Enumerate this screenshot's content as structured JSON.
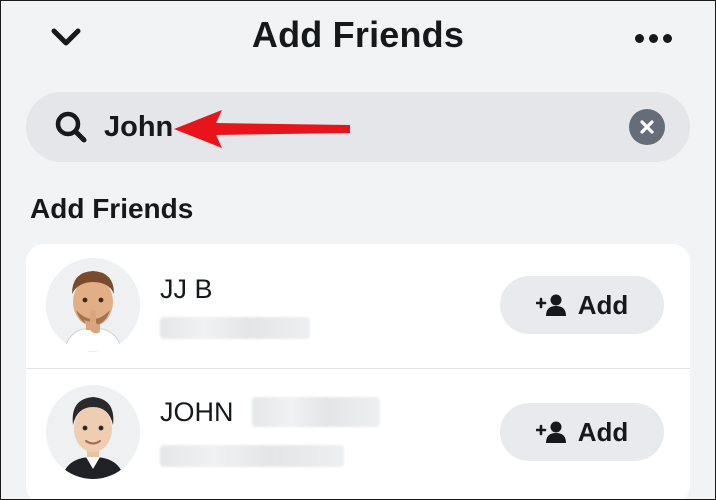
{
  "header": {
    "title": "Add Friends",
    "back_icon": "chevron-down-icon",
    "more_icon": "more-dots-icon"
  },
  "search": {
    "value": "John",
    "icon": "search-icon",
    "clear_icon": "clear-x-icon"
  },
  "annotation": {
    "type": "red-arrow",
    "color": "#e8141b"
  },
  "section": {
    "title": "Add Friends"
  },
  "results": [
    {
      "name": "JJ B",
      "add_label": "Add",
      "add_icon": "add-friend-icon"
    },
    {
      "name": "JOHN",
      "add_label": "Add",
      "add_icon": "add-friend-icon"
    }
  ],
  "colors": {
    "background": "#f2f3f5",
    "search_bg": "#e4e6e9",
    "button_bg": "#e8eaed",
    "text": "#16191c"
  }
}
